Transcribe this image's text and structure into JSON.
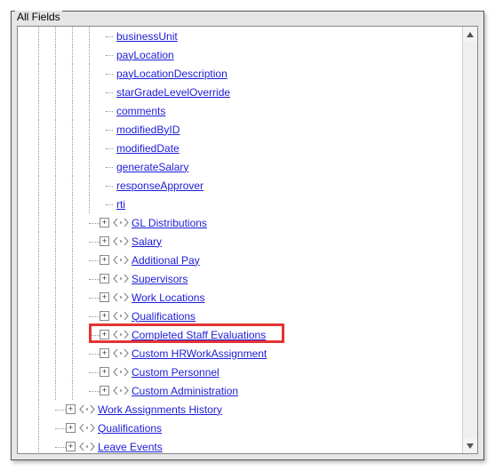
{
  "panel": {
    "title": "All Fields"
  },
  "leaves": [
    {
      "label": "businessUnit"
    },
    {
      "label": "payLocation"
    },
    {
      "label": "payLocationDescription"
    },
    {
      "label": "starGradeLevelOverride"
    },
    {
      "label": "comments"
    },
    {
      "label": "modifiedByID"
    },
    {
      "label": "modifiedDate"
    },
    {
      "label": "generateSalary"
    },
    {
      "label": "responseApprover"
    },
    {
      "label": "rti"
    }
  ],
  "inner_nodes": [
    {
      "label": "GL Distributions"
    },
    {
      "label": "Salary"
    },
    {
      "label": "Additional Pay"
    },
    {
      "label": "Supervisors"
    },
    {
      "label": "Work Locations"
    },
    {
      "label": "Qualifications"
    },
    {
      "label": "Completed Staff Evaluations",
      "highlighted": true
    },
    {
      "label": "Custom HRWorkAssignment"
    },
    {
      "label": "Custom Personnel"
    },
    {
      "label": "Custom Administration"
    }
  ],
  "outer_nodes": [
    {
      "label": "Work Assignments History"
    },
    {
      "label": "Qualifications"
    },
    {
      "label": "Leave Events"
    }
  ],
  "expander_glyph": "+"
}
